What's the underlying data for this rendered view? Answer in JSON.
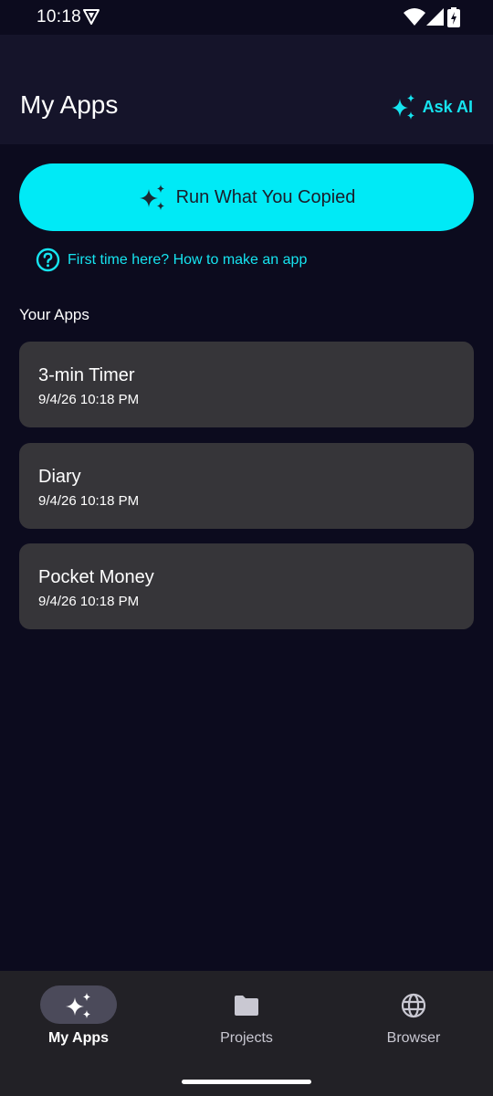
{
  "status_bar": {
    "time": "10:18"
  },
  "header": {
    "title": "My Apps",
    "ask_ai_label": "Ask AI"
  },
  "run_button": {
    "label": "Run What You Copied"
  },
  "help_link": {
    "label": "First time here? How to make an app"
  },
  "section_title": "Your Apps",
  "apps": [
    {
      "name": "3-min Timer",
      "date": "9/4/26 10:18 PM"
    },
    {
      "name": "Diary",
      "date": "9/4/26 10:18 PM"
    },
    {
      "name": "Pocket Money",
      "date": "9/4/26 10:18 PM"
    }
  ],
  "bottom_nav": {
    "items": [
      {
        "label": "My Apps",
        "icon": "sparkle-icon",
        "active": true
      },
      {
        "label": "Projects",
        "icon": "folder-icon",
        "active": false
      },
      {
        "label": "Browser",
        "icon": "globe-icon",
        "active": false
      }
    ]
  },
  "colors": {
    "accent": "#00eaf6",
    "background": "#0c0b1e",
    "header": "#15142a",
    "card": "#363539",
    "nav_background": "#222126"
  }
}
